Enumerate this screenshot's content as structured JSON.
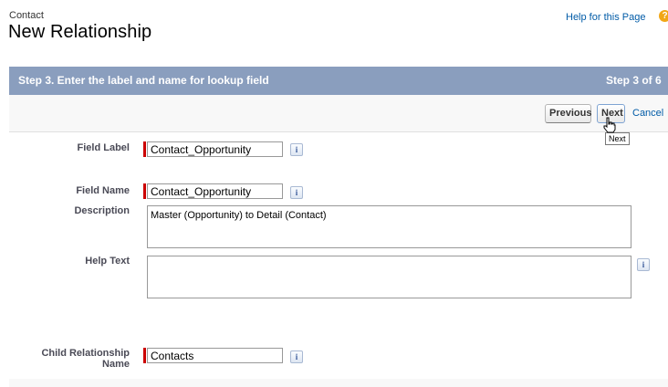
{
  "header": {
    "object_name": "Contact",
    "title": "New Relationship",
    "help_link": "Help for this Page",
    "help_icon_glyph": "?"
  },
  "step": {
    "title": "Step 3. Enter the label and name for lookup field",
    "count": "Step 3 of 6"
  },
  "buttons": {
    "previous": "Previous",
    "next": "Next",
    "cancel": "Cancel",
    "next_tooltip": "Next"
  },
  "form": {
    "field_label": {
      "label": "Field Label",
      "value": "Contact_Opportunity"
    },
    "field_name": {
      "label": "Field Name",
      "value": "Contact_Opportunity"
    },
    "description": {
      "label": "Description",
      "value": "Master (Opportunity) to Detail (Contact)"
    },
    "help_text": {
      "label": "Help Text",
      "value": ""
    },
    "child_relationship": {
      "label_line1": "Child Relationship",
      "label_line2": "Name",
      "value": "Contacts"
    }
  },
  "info_glyph": "i",
  "colors": {
    "header_bar": "#8a9ebe",
    "required_marker": "#cc0000",
    "link": "#015ba7",
    "help_icon": "#f1a716"
  }
}
